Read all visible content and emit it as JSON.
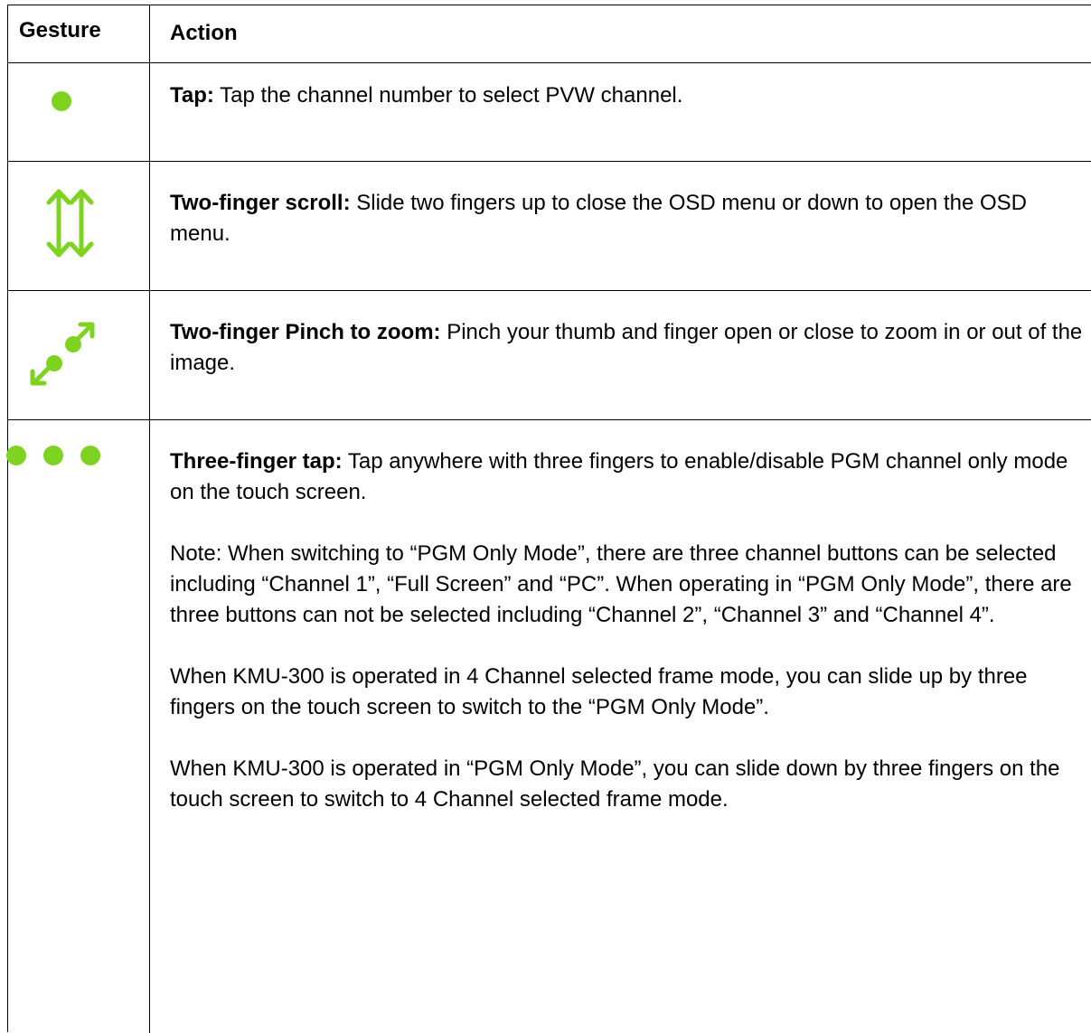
{
  "table": {
    "header": {
      "gesture": "Gesture",
      "action": "Action"
    },
    "rows": [
      {
        "icon": "single-dot-tap-icon",
        "label": "Tap:",
        "text": " Tap the channel number to select PVW channel."
      },
      {
        "icon": "two-finger-scroll-arrows-icon",
        "label": "Two-finger scroll:",
        "text": " Slide two fingers up to close the OSD menu or down to open the OSD menu."
      },
      {
        "icon": "pinch-zoom-arrows-icon",
        "label": "Two-finger Pinch to zoom:",
        "text": " Pinch your thumb and finger open or close to zoom in or out of the image."
      },
      {
        "icon": "three-dots-tap-icon",
        "label": "Three-finger tap:",
        "text": " Tap anywhere with three fingers to enable/disable PGM channel only mode on the touch screen.",
        "notes": [
          "Note: When switching to “PGM Only Mode”, there are three channel buttons can be selected including “Channel 1”, “Full Screen” and “PC”. When operating in “PGM Only Mode”, there are three buttons can not be selected including “Channel 2”, “Channel 3” and “Channel 4”.",
          "When KMU-300 is operated in 4 Channel selected frame mode, you can slide up by three fingers on the touch screen to switch to the “PGM Only Mode”.",
          "When KMU-300 is operated in “PGM Only Mode”, you can slide down by three fingers on the touch screen to switch to 4 Channel selected frame mode."
        ]
      }
    ]
  },
  "colors": {
    "icon_green": "#7ed321",
    "border": "#000000"
  }
}
